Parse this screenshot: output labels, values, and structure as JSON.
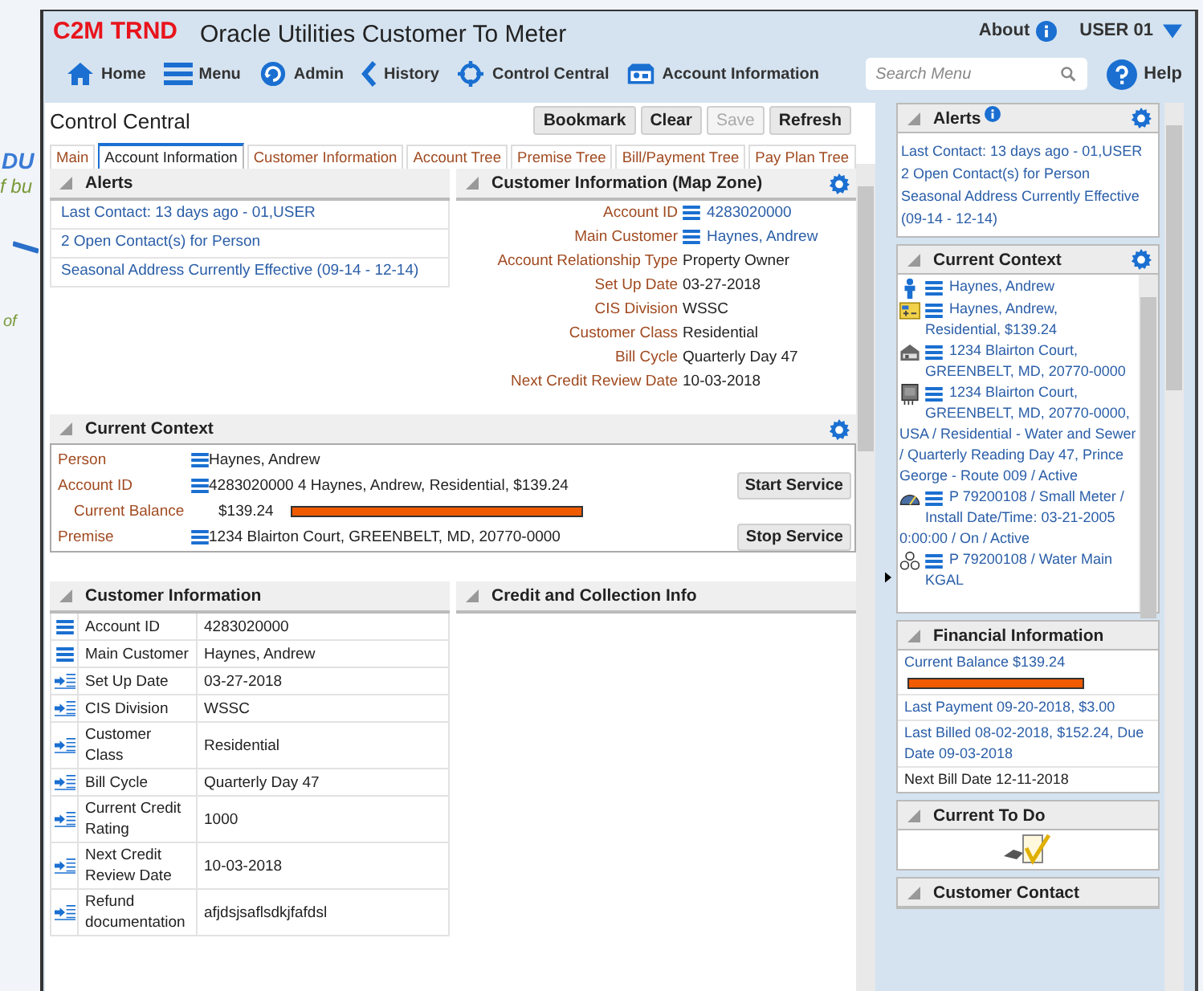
{
  "background_fragments": [
    "DU",
    "f bu",
    "of"
  ],
  "header": {
    "brand": "C2M TRND",
    "title": "Oracle Utilities Customer To Meter",
    "about": "About",
    "user": "USER 01",
    "nav": [
      {
        "label": "Home",
        "kind": "home"
      },
      {
        "label": "Menu",
        "kind": "menu"
      },
      {
        "label": "Admin",
        "kind": "admin"
      },
      {
        "label": "History",
        "kind": "history"
      },
      {
        "label": "Control Central",
        "kind": "target"
      },
      {
        "label": "Account Information",
        "kind": "card"
      }
    ],
    "search": {
      "placeholder": "Search Menu"
    },
    "help": "Help"
  },
  "portal": {
    "title": "Control Central",
    "buttons": [
      {
        "label": "Bookmark",
        "disabled": false
      },
      {
        "label": "Clear",
        "disabled": false
      },
      {
        "label": "Save",
        "disabled": true
      },
      {
        "label": "Refresh",
        "disabled": false
      }
    ],
    "tabs": [
      {
        "label": "Main",
        "selected": false
      },
      {
        "label": "Account Information",
        "selected": true
      },
      {
        "label": "Customer Information",
        "selected": false
      },
      {
        "label": "Account Tree",
        "selected": false
      },
      {
        "label": "Premise Tree",
        "selected": false
      },
      {
        "label": "Bill/Payment Tree",
        "selected": false
      },
      {
        "label": "Pay Plan Tree",
        "selected": false
      }
    ],
    "alerts_zone": {
      "title": "Alerts",
      "items": [
        "Last Contact: 13 days ago - 01,USER",
        "2 Open Contact(s) for Person",
        "Seasonal Address Currently Effective (09-14 - 12-14)"
      ]
    },
    "map_zone": {
      "title": "Customer Information (Map Zone)",
      "fields": [
        {
          "label": "Account ID",
          "value": "4283020000",
          "link": true
        },
        {
          "label": "Main Customer",
          "value": "Haynes, Andrew",
          "link": true
        },
        {
          "label": "Account Relationship Type",
          "value": "Property Owner",
          "link": false
        },
        {
          "label": "Set Up Date",
          "value": "03-27-2018",
          "link": false
        },
        {
          "label": "CIS Division",
          "value": "WSSC",
          "link": false
        },
        {
          "label": "Customer Class",
          "value": "Residential",
          "link": false
        },
        {
          "label": "Bill Cycle",
          "value": "Quarterly Day 47",
          "link": false
        },
        {
          "label": "Next Credit Review Date",
          "value": "10-03-2018",
          "link": false
        }
      ]
    },
    "context_zone": {
      "title": "Current Context",
      "rows": [
        {
          "kind": "link",
          "label": "Person",
          "value": "Haynes, Andrew"
        },
        {
          "kind": "link",
          "label": "Account ID",
          "value": "4283020000 4 Haynes, Andrew, Residential, $139.24",
          "button": "Start Service"
        },
        {
          "kind": "balance",
          "label": "Current Balance",
          "value": "$139.24"
        },
        {
          "kind": "link",
          "label": "Premise",
          "value": "1234 Blairton Court, GREENBELT, MD, 20770-0000",
          "button": "Stop Service"
        }
      ]
    },
    "customer_info": {
      "title": "Customer Information",
      "rows": [
        {
          "kind": "menu",
          "label": "Account ID",
          "value": "4283020000"
        },
        {
          "kind": "menu",
          "label": "Main Customer",
          "value": "Haynes, Andrew"
        },
        {
          "kind": "detail",
          "label": "Set Up Date",
          "value": "03-27-2018"
        },
        {
          "kind": "detail",
          "label": "CIS Division",
          "value": "WSSC"
        },
        {
          "kind": "detail",
          "label": "Customer Class",
          "value": "Residential"
        },
        {
          "kind": "detail",
          "label": "Bill Cycle",
          "value": "Quarterly Day 47"
        },
        {
          "kind": "detail",
          "label": "Current Credit Rating",
          "value": "1000"
        },
        {
          "kind": "detail",
          "label": "Next Credit Review Date",
          "value": "10-03-2018"
        },
        {
          "kind": "detail",
          "label": "Refund documentation",
          "value": "afjdsjsaflsdkjfafdsl"
        }
      ]
    },
    "credit_zone": {
      "title": "Credit and Collection Info"
    }
  },
  "dashboard": {
    "alerts": {
      "title": "Alerts",
      "items": [
        "Last Contact: 13 days ago - 01,USER",
        "2 Open Contact(s) for Person",
        "Seasonal Address Currently Effective (09-14 - 12-14)"
      ]
    },
    "context": {
      "title": "Current Context",
      "items": [
        {
          "kind": "person",
          "text": "Haynes, Andrew"
        },
        {
          "kind": "account",
          "text": "Haynes, Andrew, Residential, $139.24"
        },
        {
          "kind": "premise",
          "text": "1234 Blairton Court, GREENBELT, MD, 20770-0000"
        },
        {
          "kind": "service_point",
          "text": "1234 Blairton Court, GREENBELT, MD, 20770-0000, USA / Residential - Water and Sewer / Quarterly Reading Day 47, Prince George - Route 009 / Active"
        },
        {
          "kind": "meter",
          "text": "P 79200108 / Small Meter / Install Date/Time: 03-21-2005 0:00:00 / On / Active"
        },
        {
          "kind": "item",
          "text": "P 79200108 / Water Main KGAL"
        }
      ]
    },
    "financial": {
      "title": "Financial Information",
      "balance": "Current Balance $139.24",
      "items": [
        "Last Payment 09-20-2018, $3.00",
        "Last Billed 08-02-2018, $152.24, Due Date 09-03-2018"
      ],
      "next_bill": "Next Bill Date 12-11-2018"
    },
    "todo": {
      "title": "Current To Do"
    },
    "contact": {
      "title": "Customer Contact"
    }
  }
}
